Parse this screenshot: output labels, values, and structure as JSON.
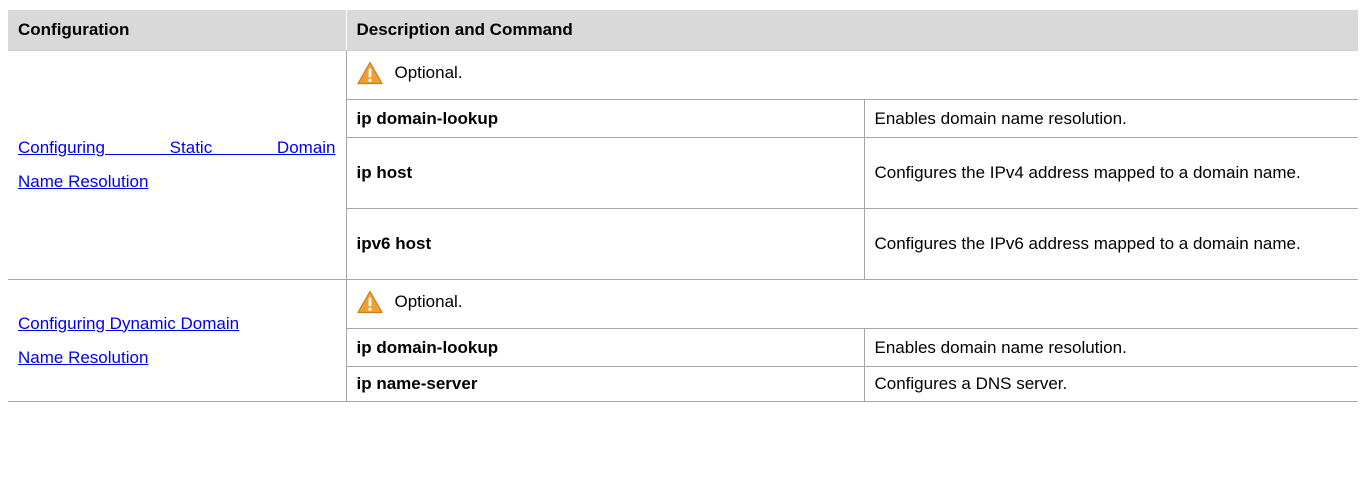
{
  "table": {
    "header": {
      "configuration": "Configuration",
      "description_and_command": "Description and Command"
    },
    "sections": [
      {
        "link_line1": "Configuring Static Domain",
        "link_line2": "Name Resolution",
        "note": "Optional.",
        "rows": [
          {
            "command": "ip domain-lookup",
            "description": "Enables domain name resolution."
          },
          {
            "command": "ip host",
            "description": "Configures the IPv4 address mapped to a domain name."
          },
          {
            "command": "ipv6 host",
            "description": "Configures the IPv6 address mapped to a domain name."
          }
        ]
      },
      {
        "link_line1": "Configuring Dynamic Domain",
        "link_line2": "Name Resolution",
        "note": "Optional.",
        "rows": [
          {
            "command": "ip domain-lookup",
            "description": "Enables domain name resolution."
          },
          {
            "command": "ip name-server",
            "description": "Configures a DNS server."
          }
        ]
      }
    ],
    "icons": {
      "warning": "warning-icon"
    },
    "colors": {
      "header_bg": "#d9d9d9",
      "link": "#0000ee",
      "warning_fill": "#f0a030"
    }
  }
}
